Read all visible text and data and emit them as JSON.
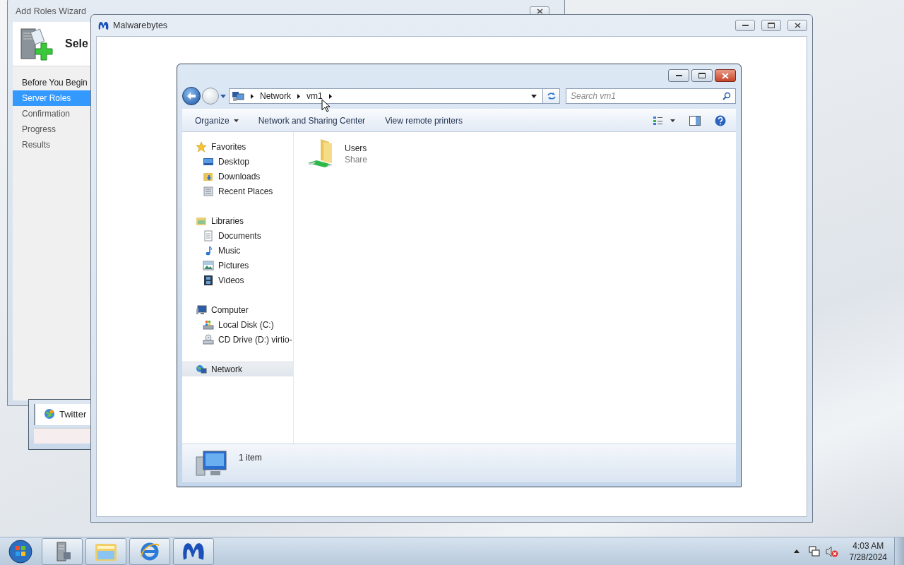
{
  "wizard_window": {
    "title": "Add Roles Wizard",
    "heading": "Sele",
    "steps": [
      {
        "label": "Before You Begin",
        "selected": false
      },
      {
        "label": "Server Roles",
        "selected": true
      },
      {
        "label": "Confirmation",
        "selected": false
      },
      {
        "label": "Progress",
        "selected": false
      },
      {
        "label": "Results",
        "selected": false
      }
    ]
  },
  "background_window": {
    "items": [
      {
        "label": "Twitter"
      }
    ]
  },
  "malwarebytes_window": {
    "title": "Malwarebytes"
  },
  "explorer_window": {
    "breadcrumb": [
      "Network",
      "vm1"
    ],
    "search": {
      "placeholder": "Search vm1"
    },
    "commands": [
      {
        "label": "Organize",
        "kind": "menu"
      },
      {
        "label": "Network and Sharing Center",
        "kind": "command"
      },
      {
        "label": "View remote printers",
        "kind": "command"
      }
    ],
    "navigation": [
      {
        "label": "Favorites",
        "kind": "favorites",
        "selected": false,
        "children": [
          {
            "label": "Desktop",
            "kind": "desktop",
            "selected": false
          },
          {
            "label": "Downloads",
            "kind": "downloads",
            "selected": false
          },
          {
            "label": "Recent Places",
            "kind": "recent",
            "selected": false
          }
        ]
      },
      {
        "label": "Libraries",
        "kind": "libraries",
        "selected": false,
        "children": [
          {
            "label": "Documents",
            "kind": "documents",
            "selected": false
          },
          {
            "label": "Music",
            "kind": "music",
            "selected": false
          },
          {
            "label": "Pictures",
            "kind": "pictures",
            "selected": false
          },
          {
            "label": "Videos",
            "kind": "videos",
            "selected": false
          }
        ]
      },
      {
        "label": "Computer",
        "kind": "computer",
        "selected": false,
        "children": [
          {
            "label": "Local Disk (C:)",
            "kind": "disk",
            "selected": false
          },
          {
            "label": "CD Drive (D:) virtio-",
            "kind": "cd",
            "selected": false
          }
        ]
      },
      {
        "label": "Network",
        "kind": "network",
        "selected": true
      }
    ],
    "items": [
      {
        "name": "Users",
        "type": "Share"
      }
    ],
    "status": "1 item"
  },
  "taskbar": {
    "buttons": [
      {
        "kind": "server-manager"
      },
      {
        "kind": "explorer"
      },
      {
        "kind": "browser"
      },
      {
        "kind": "malwarebytes"
      }
    ],
    "clock": {
      "time": "4:03 AM",
      "date": "7/28/2024"
    }
  }
}
